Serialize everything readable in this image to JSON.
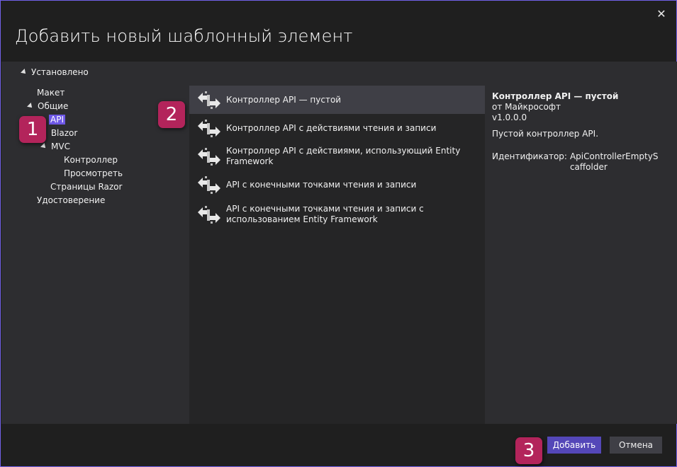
{
  "dialog": {
    "title": "Добавить новый шаблонный элемент",
    "close_glyph": "✕"
  },
  "tree": {
    "installed_label": "Установлено",
    "items": [
      {
        "label": "Макет"
      },
      {
        "label": "Общие"
      },
      {
        "label": "API",
        "selected": true
      },
      {
        "label": "Blazor"
      },
      {
        "label": "MVC"
      },
      {
        "label": "Контроллер"
      },
      {
        "label": "Просмотреть"
      },
      {
        "label": "Страницы Razor"
      },
      {
        "label": "Удостоверение"
      }
    ]
  },
  "templates": [
    {
      "label": "Контроллер API — пустой",
      "selected": true
    },
    {
      "label": "Контроллер API с действиями чтения и записи"
    },
    {
      "label": "Контроллер API с действиями, использующий Entity Framework"
    },
    {
      "label": "API с конечными точками чтения и записи"
    },
    {
      "label": "API с конечными точками чтения и записи с использованием Entity Framework"
    }
  ],
  "details": {
    "name": "Контроллер API — пустой",
    "author": "от Майкрософт",
    "version": "v1.0.0.0",
    "description": "Пустой контроллер API.",
    "id_label": "Идентификатор:",
    "id_value": "ApiControllerEmptyScaffolder"
  },
  "footer": {
    "add_label": "Добавить",
    "cancel_label": "Отмена"
  },
  "badges": [
    "1",
    "2",
    "3"
  ],
  "colors": {
    "accent": "#6e58e6",
    "badge": "#b3245b",
    "add_button": "#5447b8"
  }
}
